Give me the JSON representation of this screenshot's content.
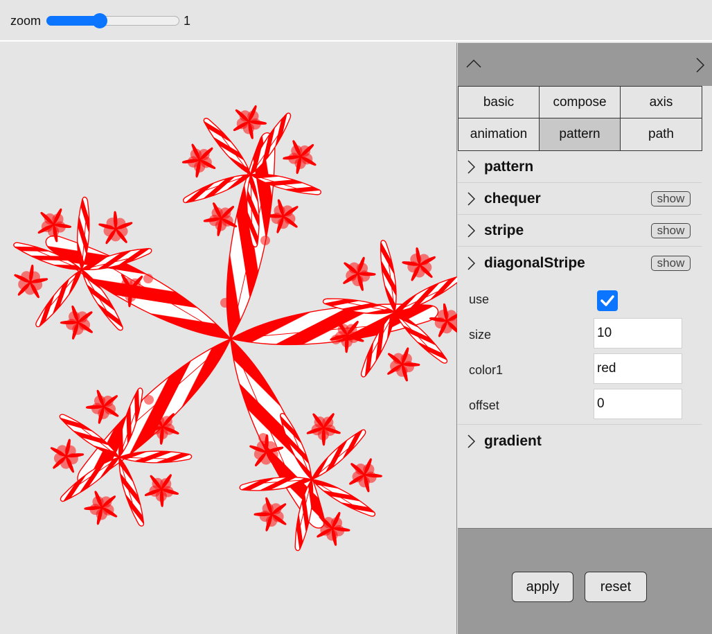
{
  "zoom": {
    "label": "zoom",
    "value": "1",
    "fraction": 0.4
  },
  "tabs": [
    {
      "label": "basic"
    },
    {
      "label": "compose"
    },
    {
      "label": "axis"
    },
    {
      "label": "animation"
    },
    {
      "label": "pattern",
      "active": true
    },
    {
      "label": "path"
    }
  ],
  "sections": {
    "pattern": {
      "title": "pattern"
    },
    "chequer": {
      "title": "chequer",
      "button": "show"
    },
    "stripe": {
      "title": "stripe",
      "button": "show"
    },
    "diagonalStripe": {
      "title": "diagonalStripe",
      "button": "show"
    },
    "gradient": {
      "title": "gradient"
    }
  },
  "fields": {
    "use": {
      "label": "use",
      "checked": true
    },
    "size": {
      "label": "size",
      "value": "10"
    },
    "color1": {
      "label": "color1",
      "value": "red"
    },
    "offset": {
      "label": "offset",
      "value": "0"
    }
  },
  "footer": {
    "apply": "apply",
    "reset": "reset"
  },
  "colors": {
    "accent": "#0b75ff",
    "stripe": "#ff0000",
    "panel_header": "#999999",
    "active_tab": "#c8c8c8"
  }
}
